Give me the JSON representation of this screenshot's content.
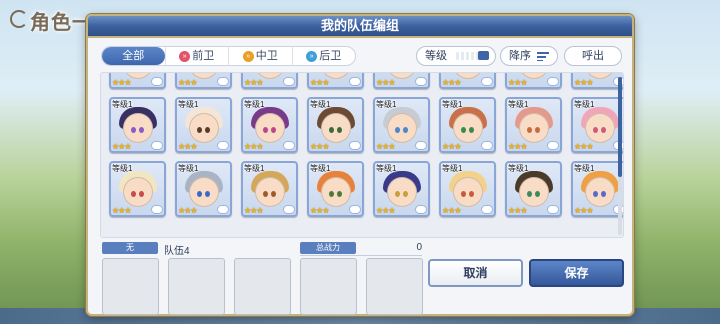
{
  "background": {
    "title": "角色一"
  },
  "dialog": {
    "title": "我的队伍编组"
  },
  "filter_tabs": [
    {
      "label": "全部",
      "icon": "",
      "active": true
    },
    {
      "label": "前卫",
      "icon": "front-position-icon",
      "color": "#e0546a",
      "active": false
    },
    {
      "label": "中卫",
      "icon": "middle-position-icon",
      "color": "#e8a024",
      "active": false
    },
    {
      "label": "后卫",
      "icon": "back-position-icon",
      "color": "#3fa0d8",
      "active": false
    }
  ],
  "controls": {
    "sort_key": "等级",
    "sort_order": "降序",
    "call": "呼出"
  },
  "cards": [
    {
      "level": "等级1",
      "stars": "★★★",
      "hair": "#3a2f63",
      "eye": "#8c5ac0",
      "frame": "#8aa6d6"
    },
    {
      "level": "等级1",
      "stars": "★★★",
      "hair": "#f3e6d8",
      "eye": "#5a3a2a",
      "frame": "#8aa6d6"
    },
    {
      "level": "等级1",
      "stars": "★★★",
      "hair": "#7a3a8a",
      "eye": "#c0448c",
      "frame": "#8aa6d6"
    },
    {
      "level": "等级1",
      "stars": "★★★",
      "hair": "#6b4a36",
      "eye": "#3a6a3a",
      "frame": "#8aa6d6"
    },
    {
      "level": "等级1",
      "stars": "★★★",
      "hair": "#c7ccd4",
      "eye": "#4a86c8",
      "frame": "#8aa6d6"
    },
    {
      "level": "等级1",
      "stars": "★★★",
      "hair": "#c8704a",
      "eye": "#3a8a4a",
      "frame": "#8aa6d6"
    },
    {
      "level": "等级1",
      "stars": "★★★",
      "hair": "#e39a8c",
      "eye": "#c86a3a",
      "frame": "#8aa6d6"
    },
    {
      "level": "等级1",
      "stars": "★★★",
      "hair": "#f0a6b8",
      "eye": "#d05a7a",
      "frame": "#8aa6d6"
    },
    {
      "level": "等级1",
      "stars": "★★★",
      "hair": "#f2e6c0",
      "eye": "#c84a4a",
      "frame": "#8aa6d6"
    },
    {
      "level": "等级1",
      "stars": "★★★",
      "hair": "#a8b4c6",
      "eye": "#3a6ac8",
      "frame": "#8aa6d6"
    },
    {
      "level": "等级1",
      "stars": "★★★",
      "hair": "#d4a85a",
      "eye": "#a05a2a",
      "frame": "#8aa6d6"
    },
    {
      "level": "等级1",
      "stars": "★★★",
      "hair": "#e8823a",
      "eye": "#4a7a3a",
      "frame": "#8aa6d6"
    },
    {
      "level": "等级1",
      "stars": "★★★",
      "hair": "#3a3a8a",
      "eye": "#c8a03a",
      "frame": "#8aa6d6"
    },
    {
      "level": "等级1",
      "stars": "★★★",
      "hair": "#f2d28a",
      "eye": "#c85a3a",
      "frame": "#8aa6d6"
    },
    {
      "level": "等级1",
      "stars": "★★★",
      "hair": "#4a3a2a",
      "eye": "#3a8a5a",
      "frame": "#8aa6d6"
    },
    {
      "level": "等级1",
      "stars": "★★★",
      "hair": "#f0a044",
      "eye": "#5a6ac8",
      "frame": "#8aa6d6"
    }
  ],
  "team": {
    "label": "无",
    "name": "队伍4",
    "power_label": "总战力",
    "power_value": "0"
  },
  "buttons": {
    "cancel": "取消",
    "save": "保存"
  },
  "colors": {
    "accent": "#3d62a0",
    "header_gold": "#c6b27d",
    "star": "#f2b31b"
  }
}
